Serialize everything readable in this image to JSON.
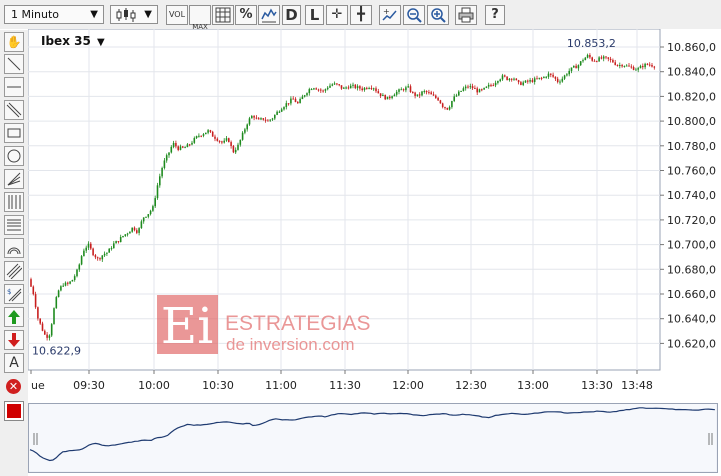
{
  "toolbar": {
    "interval": "1 Minuto",
    "vol": "VOL",
    "maxmin": "MAX\nMIN",
    "percent": "%",
    "d_label": "D",
    "l_label": "L",
    "help": "?"
  },
  "chart": {
    "symbol": "Ibex 35",
    "symbol_arrow": "▼",
    "high_label": "10.853,2",
    "low_label": "10.622,9",
    "y_ticks": [
      "10.860,0",
      "10.840,0",
      "10.820,0",
      "10.800,0",
      "10.780,0",
      "10.760,0",
      "10.740,0",
      "10.720,0",
      "10.700,0",
      "10.680,0",
      "10.660,0",
      "10.640,0",
      "10.620,0"
    ],
    "x_ticks": [
      "ue",
      "09:30",
      "10:00",
      "10:30",
      "11:00",
      "11:30",
      "12:00",
      "12:30",
      "13:00",
      "13:30",
      "13:48"
    ],
    "up_color": "#1e8a1e",
    "down_color": "#c81e1e"
  },
  "watermark": {
    "logo_letters": "Ei",
    "line1": "ESTRATEGIAS",
    "line2": "de inversion.com",
    "color": "#e06060"
  },
  "chart_data": {
    "type": "candlestick",
    "title": "Ibex 35",
    "xlabel": "",
    "ylabel": "",
    "ylim": [
      10610,
      10870
    ],
    "close_path": [
      [
        0,
        10672
      ],
      [
        5,
        10662
      ],
      [
        10,
        10640
      ],
      [
        15,
        10630
      ],
      [
        18,
        10625
      ],
      [
        22,
        10628
      ],
      [
        26,
        10648
      ],
      [
        30,
        10662
      ],
      [
        35,
        10668
      ],
      [
        40,
        10668
      ],
      [
        45,
        10672
      ],
      [
        50,
        10680
      ],
      [
        55,
        10695
      ],
      [
        60,
        10700
      ],
      [
        65,
        10693
      ],
      [
        70,
        10688
      ],
      [
        75,
        10692
      ],
      [
        80,
        10694
      ],
      [
        85,
        10700
      ],
      [
        90,
        10703
      ],
      [
        95,
        10707
      ],
      [
        100,
        10710
      ],
      [
        105,
        10714
      ],
      [
        110,
        10710
      ],
      [
        115,
        10722
      ],
      [
        120,
        10725
      ],
      [
        125,
        10730
      ],
      [
        130,
        10750
      ],
      [
        135,
        10765
      ],
      [
        140,
        10773
      ],
      [
        145,
        10782
      ],
      [
        150,
        10778
      ],
      [
        155,
        10778
      ],
      [
        160,
        10780
      ],
      [
        165,
        10784
      ],
      [
        170,
        10788
      ],
      [
        175,
        10790
      ],
      [
        180,
        10792
      ],
      [
        185,
        10788
      ],
      [
        190,
        10785
      ],
      [
        195,
        10782
      ],
      [
        200,
        10786
      ],
      [
        205,
        10775
      ],
      [
        210,
        10780
      ],
      [
        215,
        10790
      ],
      [
        220,
        10800
      ],
      [
        225,
        10805
      ],
      [
        230,
        10800
      ],
      [
        235,
        10802
      ],
      [
        240,
        10800
      ],
      [
        245,
        10803
      ],
      [
        250,
        10808
      ],
      [
        255,
        10812
      ],
      [
        260,
        10815
      ],
      [
        265,
        10818
      ],
      [
        270,
        10814
      ],
      [
        275,
        10820
      ],
      [
        280,
        10825
      ],
      [
        285,
        10828
      ],
      [
        290,
        10826
      ],
      [
        295,
        10824
      ],
      [
        300,
        10828
      ],
      [
        305,
        10830
      ],
      [
        310,
        10829
      ],
      [
        315,
        10826
      ],
      [
        320,
        10828
      ],
      [
        325,
        10828
      ],
      [
        330,
        10827
      ],
      [
        335,
        10826
      ],
      [
        340,
        10828
      ],
      [
        345,
        10828
      ],
      [
        350,
        10823
      ],
      [
        355,
        10820
      ],
      [
        360,
        10818
      ],
      [
        365,
        10822
      ],
      [
        370,
        10824
      ],
      [
        375,
        10826
      ],
      [
        380,
        10827
      ],
      [
        385,
        10822
      ],
      [
        390,
        10820
      ],
      [
        395,
        10824
      ],
      [
        400,
        10823
      ],
      [
        405,
        10820
      ],
      [
        410,
        10818
      ],
      [
        415,
        10812
      ],
      [
        420,
        10810
      ],
      [
        425,
        10818
      ],
      [
        430,
        10822
      ],
      [
        435,
        10826
      ],
      [
        440,
        10828
      ],
      [
        445,
        10827
      ],
      [
        450,
        10824
      ],
      [
        455,
        10825
      ],
      [
        460,
        10828
      ],
      [
        465,
        10830
      ],
      [
        470,
        10834
      ],
      [
        475,
        10836
      ],
      [
        480,
        10834
      ],
      [
        485,
        10836
      ],
      [
        490,
        10830
      ],
      [
        495,
        10831
      ],
      [
        500,
        10832
      ],
      [
        505,
        10833
      ],
      [
        510,
        10834
      ],
      [
        515,
        10835
      ],
      [
        520,
        10838
      ],
      [
        525,
        10836
      ],
      [
        530,
        10832
      ],
      [
        535,
        10835
      ],
      [
        540,
        10840
      ],
      [
        545,
        10843
      ],
      [
        550,
        10845
      ],
      [
        555,
        10850
      ],
      [
        560,
        10853
      ],
      [
        565,
        10849
      ],
      [
        570,
        10850
      ],
      [
        575,
        10851
      ],
      [
        580,
        10850
      ],
      [
        585,
        10848
      ],
      [
        590,
        10845
      ],
      [
        595,
        10846
      ],
      [
        600,
        10844
      ],
      [
        605,
        10843
      ],
      [
        610,
        10842
      ],
      [
        615,
        10845
      ],
      [
        620,
        10846
      ],
      [
        625,
        10845
      ]
    ],
    "x_tick_positions": [
      [
        "ue",
        3
      ],
      [
        "09:30",
        61
      ],
      [
        "10:00",
        126
      ],
      [
        "10:30",
        190
      ],
      [
        "11:00",
        253
      ],
      [
        "11:30",
        317
      ],
      [
        "12:00",
        380
      ],
      [
        "12:30",
        443
      ],
      [
        "13:00",
        505
      ],
      [
        "13:30",
        569
      ],
      [
        "13:48",
        609
      ]
    ],
    "high": 10853.2,
    "low": 10622.9
  }
}
